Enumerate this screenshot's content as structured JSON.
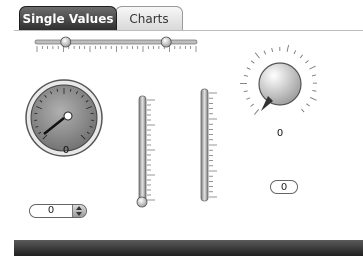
{
  "tabs": [
    {
      "label": "Single Values",
      "active": true
    },
    {
      "label": "Charts",
      "active": false
    }
  ],
  "controls": {
    "range_slider": {
      "low": 0.19,
      "high": 0.81
    },
    "dial_gauge": {
      "value": "0"
    },
    "vertical_slider": {
      "value": 0
    },
    "vertical_meter": {
      "value": 0
    },
    "knob": {
      "value": "0"
    },
    "knob_value_field": "0",
    "spinner_value": "0"
  },
  "colors": {
    "tab_active": "#4a4a4a",
    "panel_border": "#bcbcbc",
    "bottom_bar": "#2f2f2f",
    "gauge_face": "#8a8a8a",
    "knob_face": "#c8c8c8"
  },
  "icons": {
    "spinner_up": "triangle-up-icon",
    "spinner_down": "triangle-down-icon"
  }
}
